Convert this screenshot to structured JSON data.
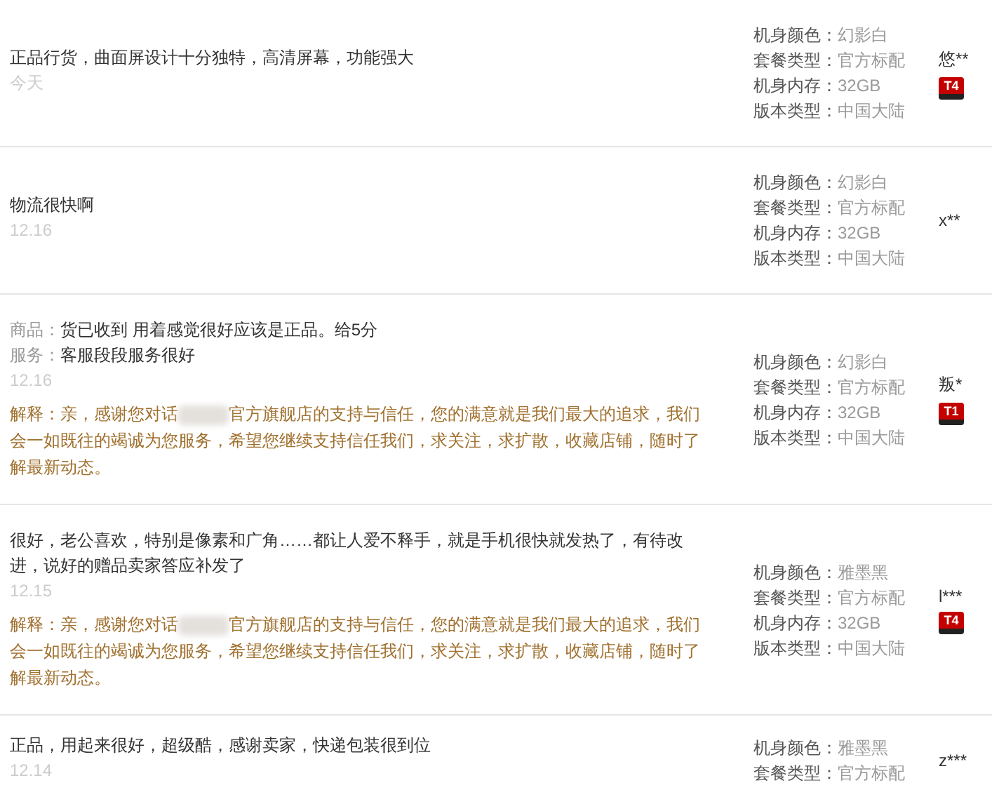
{
  "reviews": [
    {
      "comment": [
        {
          "text": "正品行货，曲面屏设计十分独特，高清屏幕，功能强大"
        }
      ],
      "date": "今天",
      "specs": [
        {
          "label": "机身颜色：",
          "value": "幻影白"
        },
        {
          "label": "套餐类型：",
          "value": "官方标配"
        },
        {
          "label": "机身内存：",
          "value": "32GB"
        },
        {
          "label": "版本类型：",
          "value": "中国大陆"
        }
      ],
      "user": {
        "name": "悠**",
        "badge": "T4"
      }
    },
    {
      "comment": [
        {
          "text": "物流很快啊"
        }
      ],
      "date": "12.16",
      "specs": [
        {
          "label": "机身颜色：",
          "value": "幻影白"
        },
        {
          "label": "套餐类型：",
          "value": "官方标配"
        },
        {
          "label": "机身内存：",
          "value": "32GB"
        },
        {
          "label": "版本类型：",
          "value": "中国大陆"
        }
      ],
      "user": {
        "name": "x**"
      }
    },
    {
      "comment": [
        {
          "label": "商品：",
          "text": "货已收到 用着感觉很好应该是正品。给5分"
        },
        {
          "label": "服务：",
          "text": "客服段段服务很好"
        }
      ],
      "date": "12.16",
      "reply": {
        "before": "解释：亲，感谢您对话",
        "after": "官方旗舰店的支持与信任，您的满意就是我们最大的追求，我们会一如既往的竭诚为您服务，希望您继续支持信任我们，求关注，求扩散，收藏店铺，随时了解最新动态。"
      },
      "specs": [
        {
          "label": "机身颜色：",
          "value": "幻影白"
        },
        {
          "label": "套餐类型：",
          "value": "官方标配"
        },
        {
          "label": "机身内存：",
          "value": "32GB"
        },
        {
          "label": "版本类型：",
          "value": "中国大陆"
        }
      ],
      "user": {
        "name": "叛*",
        "badge": "T1"
      }
    },
    {
      "comment": [
        {
          "text": "很好，老公喜欢，特别是像素和广角……都让人爱不释手，就是手机很快就发热了，有待改进，说好的赠品卖家答应补发了"
        }
      ],
      "date": "12.15",
      "reply": {
        "before": "解释：亲，感谢您对话",
        "after": "官方旗舰店的支持与信任，您的满意就是我们最大的追求，我们会一如既往的竭诚为您服务，希望您继续支持信任我们，求关注，求扩散，收藏店铺，随时了解最新动态。"
      },
      "specs": [
        {
          "label": "机身颜色：",
          "value": "雅墨黑"
        },
        {
          "label": "套餐类型：",
          "value": "官方标配"
        },
        {
          "label": "机身内存：",
          "value": "32GB"
        },
        {
          "label": "版本类型：",
          "value": "中国大陆"
        }
      ],
      "user": {
        "name": "l***",
        "badge": "T4"
      }
    },
    {
      "comment": [
        {
          "text": "正品，用起来很好，超级酷，感谢卖家，快递包装很到位"
        }
      ],
      "date": "12.14",
      "specs": [
        {
          "label": "机身颜色：",
          "value": "雅墨黑"
        },
        {
          "label": "套餐类型：",
          "value": "官方标配"
        }
      ],
      "user": {
        "name": "z***"
      }
    }
  ]
}
